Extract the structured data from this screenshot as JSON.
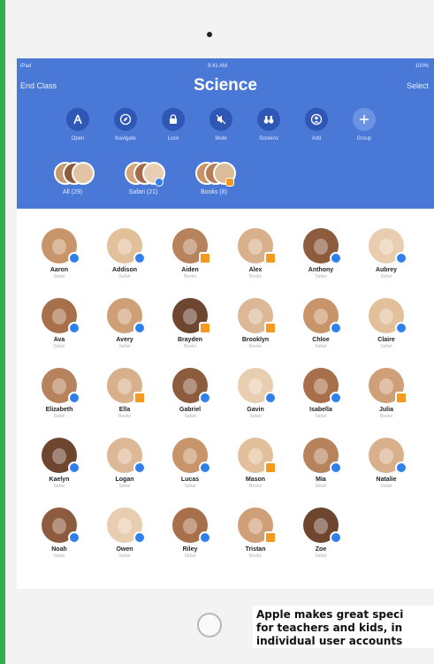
{
  "status_bar": {
    "left": "iPad",
    "time": "9:41 AM",
    "battery": "100%"
  },
  "nav": {
    "left_button": "End Class",
    "title": "Science",
    "right_button": "Select"
  },
  "actions": [
    {
      "label": "Open",
      "icon": "open-icon"
    },
    {
      "label": "Navigate",
      "icon": "compass-icon"
    },
    {
      "label": "Lock",
      "icon": "lock-icon"
    },
    {
      "label": "Mute",
      "icon": "mute-icon"
    },
    {
      "label": "Screens",
      "icon": "binoculars-icon"
    },
    {
      "label": "Add",
      "icon": "add-person-icon"
    },
    {
      "label": "Group",
      "icon": "plus-icon"
    }
  ],
  "groups": [
    {
      "label": "All (29)"
    },
    {
      "label": "Safari (21)"
    },
    {
      "label": "Books (8)"
    }
  ],
  "students": [
    {
      "name": "Aaron",
      "app": "Safari"
    },
    {
      "name": "Addison",
      "app": "Safari"
    },
    {
      "name": "Aiden",
      "app": "Books"
    },
    {
      "name": "Alex",
      "app": "Books"
    },
    {
      "name": "Anthony",
      "app": "Safari"
    },
    {
      "name": "Aubrey",
      "app": "Safari"
    },
    {
      "name": "Ava",
      "app": "Safari"
    },
    {
      "name": "Avery",
      "app": "Safari"
    },
    {
      "name": "Brayden",
      "app": "Books"
    },
    {
      "name": "Brooklyn",
      "app": "Books"
    },
    {
      "name": "Chloe",
      "app": "Safari"
    },
    {
      "name": "Claire",
      "app": "Safari"
    },
    {
      "name": "Elizabeth",
      "app": "Safari"
    },
    {
      "name": "Ella",
      "app": "Books"
    },
    {
      "name": "Gabriel",
      "app": "Safari"
    },
    {
      "name": "Gavin",
      "app": "Safari"
    },
    {
      "name": "Isabella",
      "app": "Safari"
    },
    {
      "name": "Julia",
      "app": "Books"
    },
    {
      "name": "Kaelyn",
      "app": "Safari"
    },
    {
      "name": "Logan",
      "app": "Safari"
    },
    {
      "name": "Lucas",
      "app": "Safari"
    },
    {
      "name": "Mason",
      "app": "Books"
    },
    {
      "name": "Mia",
      "app": "Safari"
    },
    {
      "name": "Natalie",
      "app": "Safari"
    },
    {
      "name": "Noah",
      "app": "Safari"
    },
    {
      "name": "Owen",
      "app": "Safari"
    },
    {
      "name": "Riley",
      "app": "Safari"
    },
    {
      "name": "Tristan",
      "app": "Books"
    },
    {
      "name": "Zoe",
      "app": "Safari"
    }
  ],
  "caption": {
    "line1": "Apple makes great speci",
    "line2": "for teachers and kids, in",
    "line3": "individual user accounts"
  },
  "colors": {
    "header": "#4a78d6",
    "safari_badge": "#2f80ed",
    "books_badge": "#f59a1f",
    "side_bar": "#2fb04a"
  }
}
